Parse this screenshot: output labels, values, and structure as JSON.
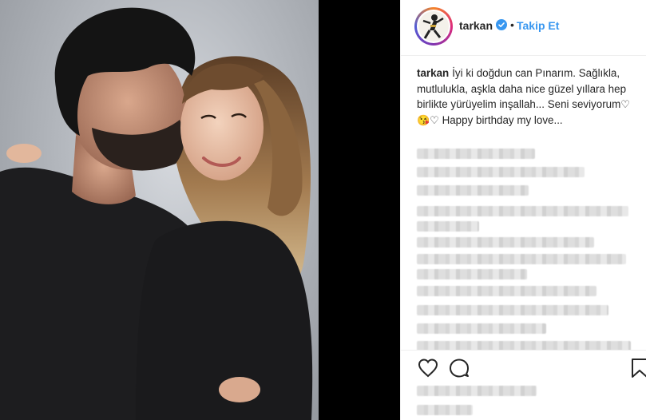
{
  "post": {
    "username": "tarkan",
    "follow_label": "Takip Et",
    "caption_user": "tarkan",
    "caption_text": "İyi ki doğdun can Pınarım. Sağlıkla, mutlulukla, aşkla daha nice güzel yıllara hep birlikte yürüyelim inşallah... Seni seviyorum",
    "caption_emoji": "♡😘♡",
    "caption_tail": " Happy birthday my love..."
  },
  "icons": {
    "verified": "verified-badge-icon",
    "like": "heart-icon",
    "comment": "comment-icon",
    "save": "bookmark-icon"
  },
  "colors": {
    "accent": "#3897f0",
    "verified": "#3897f0",
    "text": "#262626",
    "border": "#efefef"
  }
}
